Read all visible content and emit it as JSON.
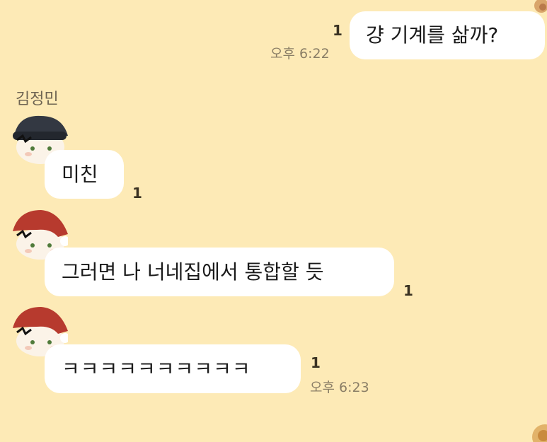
{
  "messages": [
    {
      "text": "걍 기계를 삶까?",
      "unread": "1",
      "time": "오후 6:22"
    },
    {
      "sender": "김정민"
    },
    {
      "text": "미친",
      "unread": "1"
    },
    {
      "text": "그러면 나 너네집에서 통합할 듯",
      "unread": "1"
    },
    {
      "text": "ㅋㅋㅋㅋㅋㅋㅋㅋㅋㅋ",
      "unread": "1",
      "time": "오후 6:23"
    }
  ],
  "colors": {
    "background": "#fdeab6",
    "bubble": "#ffffff",
    "santa_hat": "#b73a2e",
    "beanie": "#333842"
  },
  "icons": [
    "beanie-avatar-icon",
    "santa-avatar-icon"
  ]
}
